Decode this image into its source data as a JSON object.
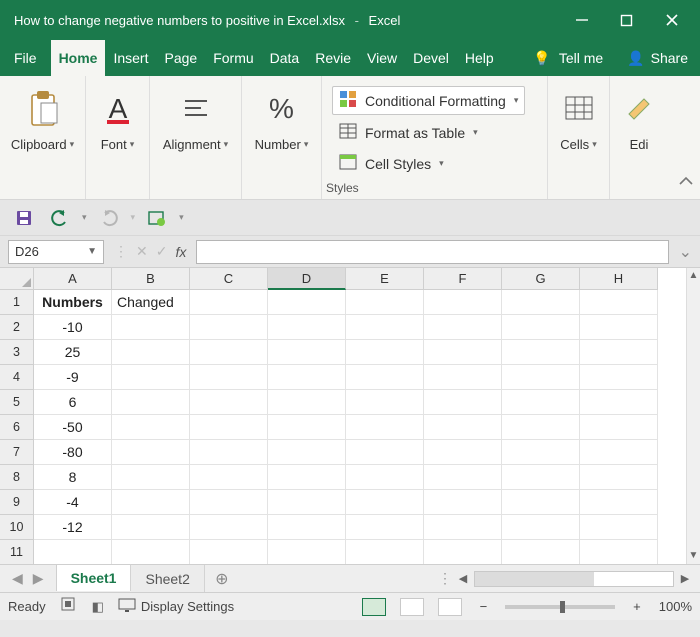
{
  "titlebar": {
    "filename": "How to change negative numbers to positive in Excel.xlsx",
    "app": "Excel"
  },
  "tabs": {
    "file": "File",
    "items": [
      "Home",
      "Insert",
      "Page",
      "Formu",
      "Data",
      "Revie",
      "View",
      "Devel",
      "Help"
    ],
    "active_index": 0,
    "tellme": "Tell me",
    "share": "Share"
  },
  "ribbon": {
    "clipboard": "Clipboard",
    "font": "Font",
    "alignment": "Alignment",
    "number": "Number",
    "percent_symbol": "%",
    "cond_format": "Conditional Formatting",
    "format_table": "Format as Table",
    "cell_styles": "Cell Styles",
    "styles": "Styles",
    "cells": "Cells",
    "editing": "Edi"
  },
  "formula_bar": {
    "namebox": "D26",
    "formula": ""
  },
  "grid": {
    "columns": [
      "A",
      "B",
      "C",
      "D",
      "E",
      "F",
      "G",
      "H"
    ],
    "active_col": "D",
    "rows": [
      {
        "n": 1,
        "A": "Numbers",
        "B": "Changed"
      },
      {
        "n": 2,
        "A": "-10"
      },
      {
        "n": 3,
        "A": "25"
      },
      {
        "n": 4,
        "A": "-9"
      },
      {
        "n": 5,
        "A": "6"
      },
      {
        "n": 6,
        "A": "-50"
      },
      {
        "n": 7,
        "A": "-80"
      },
      {
        "n": 8,
        "A": "8"
      },
      {
        "n": 9,
        "A": "-4"
      },
      {
        "n": 10,
        "A": "-12"
      },
      {
        "n": 11
      }
    ]
  },
  "sheets": {
    "items": [
      "Sheet1",
      "Sheet2"
    ],
    "active_index": 0
  },
  "status": {
    "ready": "Ready",
    "display": "Display Settings",
    "zoom": "100%"
  }
}
